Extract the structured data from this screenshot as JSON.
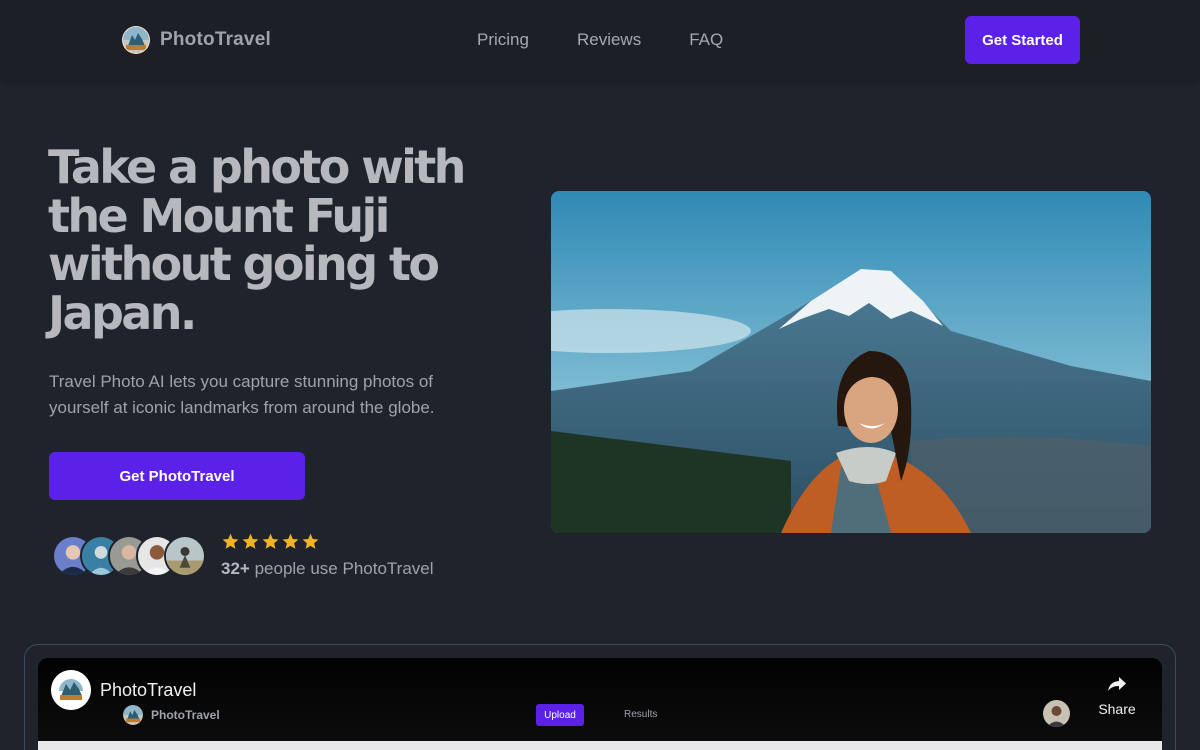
{
  "colors": {
    "background": "#1f232b",
    "navbar": "#1c1f25",
    "accent": "#5b21e8",
    "star": "#f0b429",
    "frame_border": "#3e4b5e"
  },
  "nav": {
    "brand": "PhotoTravel",
    "brand_icon": "phototravel-logo",
    "links": [
      "Pricing",
      "Reviews",
      "FAQ"
    ],
    "cta": "Get Started"
  },
  "hero": {
    "title": "Take a photo with the Mount Fuji without going to Japan.",
    "subtitle": "Travel Photo AI lets you capture stunning photos of yourself at iconic landmarks from around the globe.",
    "cta": "Get PhotoTravel",
    "rating_stars": 5,
    "users_count": "32+",
    "users_text": "people use PhotoTravel",
    "image": "woman-mount-fuji-photo"
  },
  "video": {
    "channel": "PhotoTravel",
    "share_label": "Share",
    "inner_brand": "PhotoTravel",
    "inner_tabs": [
      "Upload",
      "Results"
    ]
  }
}
